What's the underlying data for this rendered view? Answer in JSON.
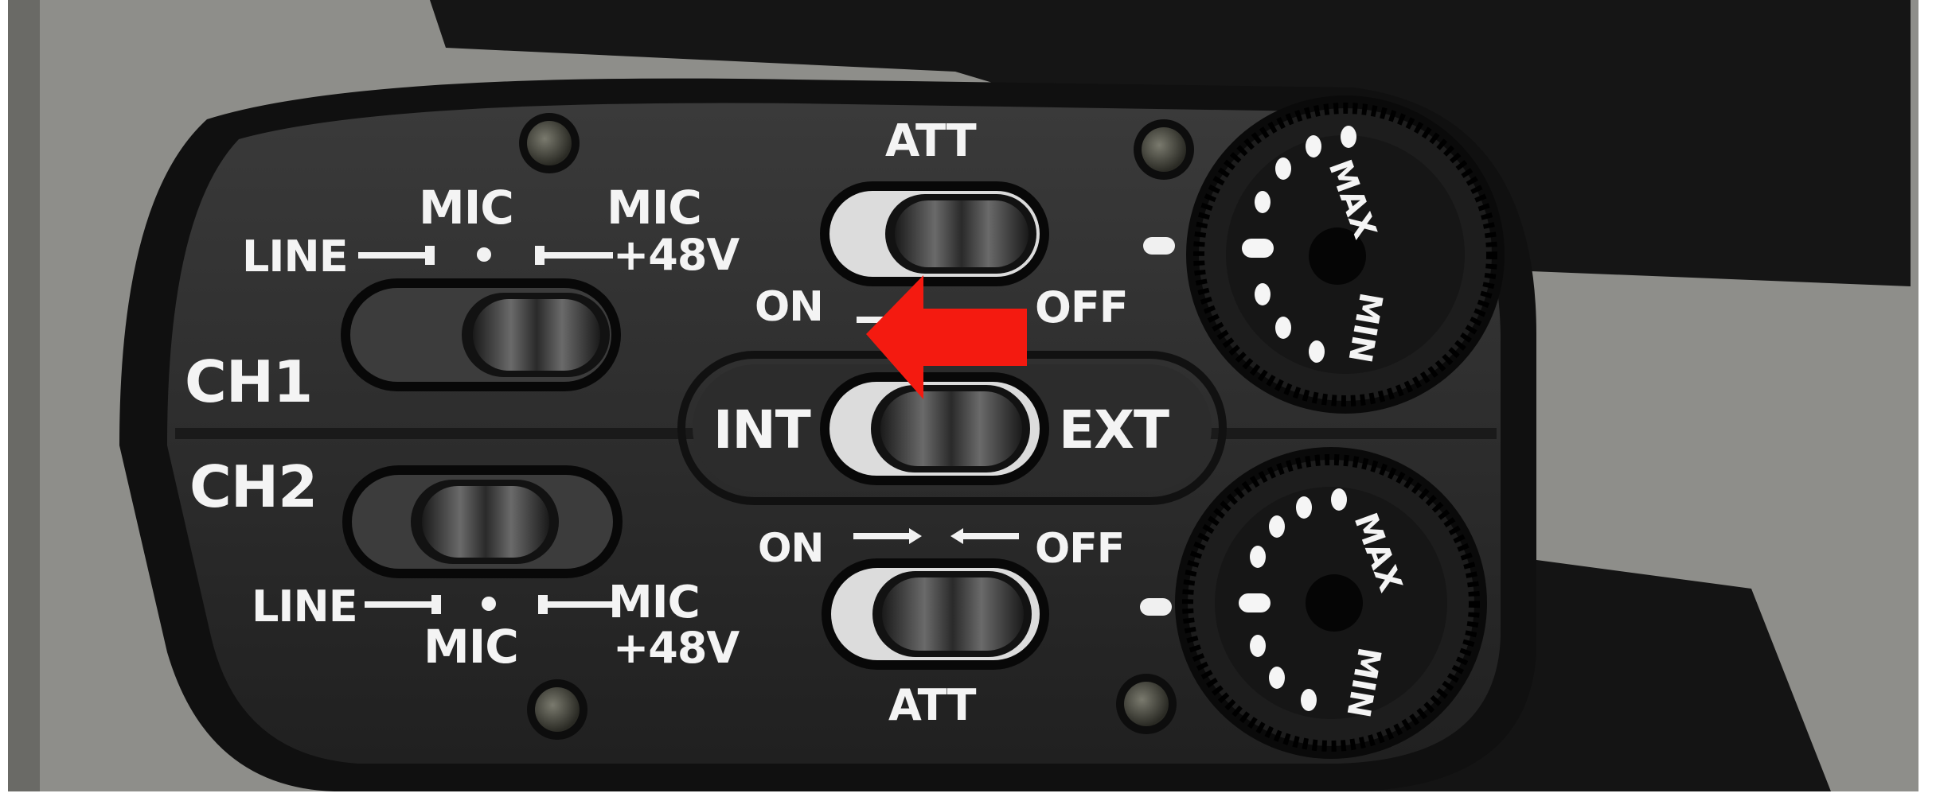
{
  "panel": {
    "ch1_label": "CH1",
    "ch2_label": "CH2",
    "ch1_switch": {
      "left": "LINE",
      "middle": "MIC",
      "right_line1": "MIC",
      "right_line2": "+48V"
    },
    "ch2_switch": {
      "left": "LINE",
      "middle": "MIC",
      "right_line1": "MIC",
      "right_line2": "+48V"
    },
    "att_top": {
      "title": "ATT",
      "on": "ON",
      "off": "OFF"
    },
    "input_select": {
      "left": "INT",
      "right": "EXT"
    },
    "att_bottom": {
      "title": "ATT",
      "on": "ON",
      "off": "OFF"
    },
    "dial_top": {
      "max": "MAX",
      "min": "MIN"
    },
    "dial_bottom": {
      "max": "MAX",
      "min": "MIN"
    }
  },
  "annotation": {
    "arrow_color": "#f41a10",
    "arrow_direction": "left"
  }
}
